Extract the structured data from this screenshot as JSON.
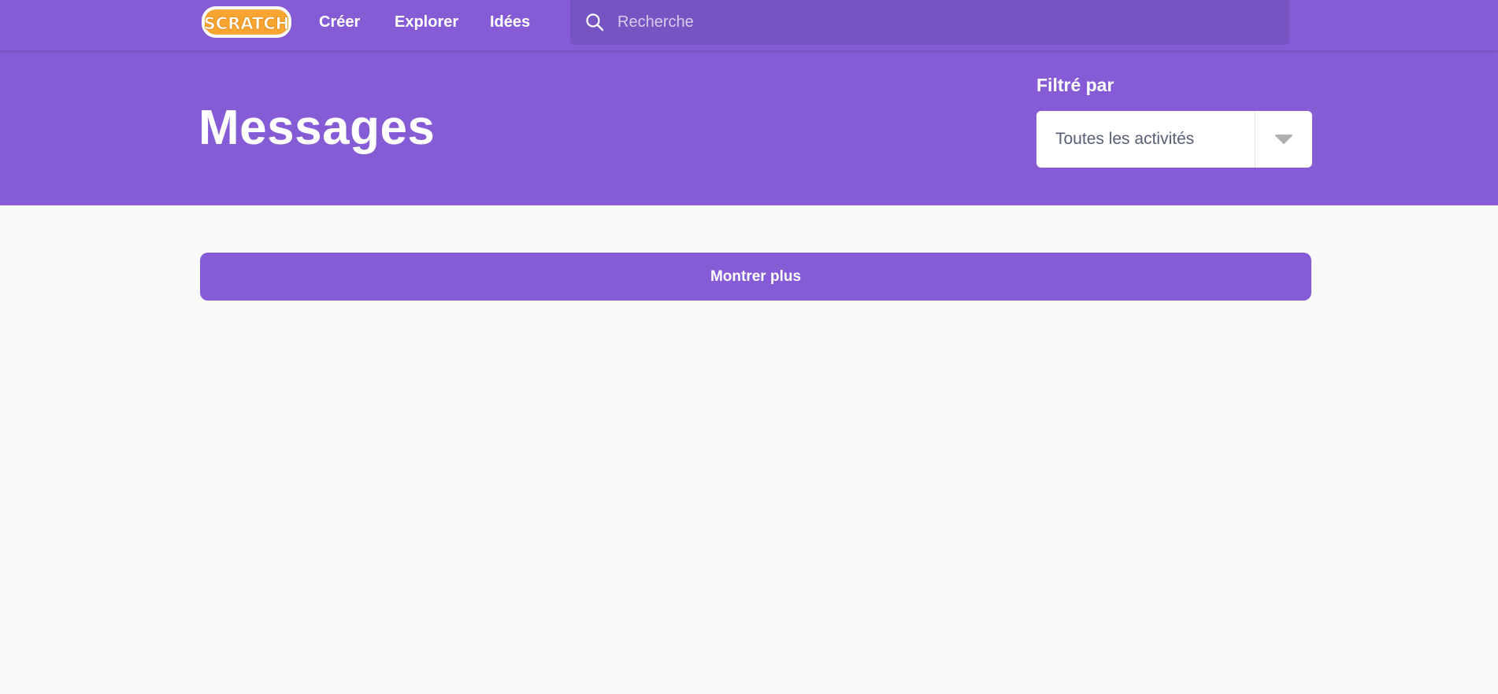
{
  "nav": {
    "logo_text": "SCRATCH",
    "create": "Créer",
    "explore": "Explorer",
    "ideas": "Idées",
    "search_placeholder": "Recherche"
  },
  "header": {
    "title": "Messages",
    "filter_label": "Filtré par",
    "filter_value": "Toutes les activités"
  },
  "main": {
    "show_more": "Montrer plus"
  },
  "colors": {
    "brand": "#855cd6",
    "search_bg": "#7654c2",
    "logo_orange": "#f7a530",
    "page_bg": "#f9f9f9"
  },
  "icons": {
    "search": "search-icon",
    "dropdown": "chevron-down-icon"
  }
}
